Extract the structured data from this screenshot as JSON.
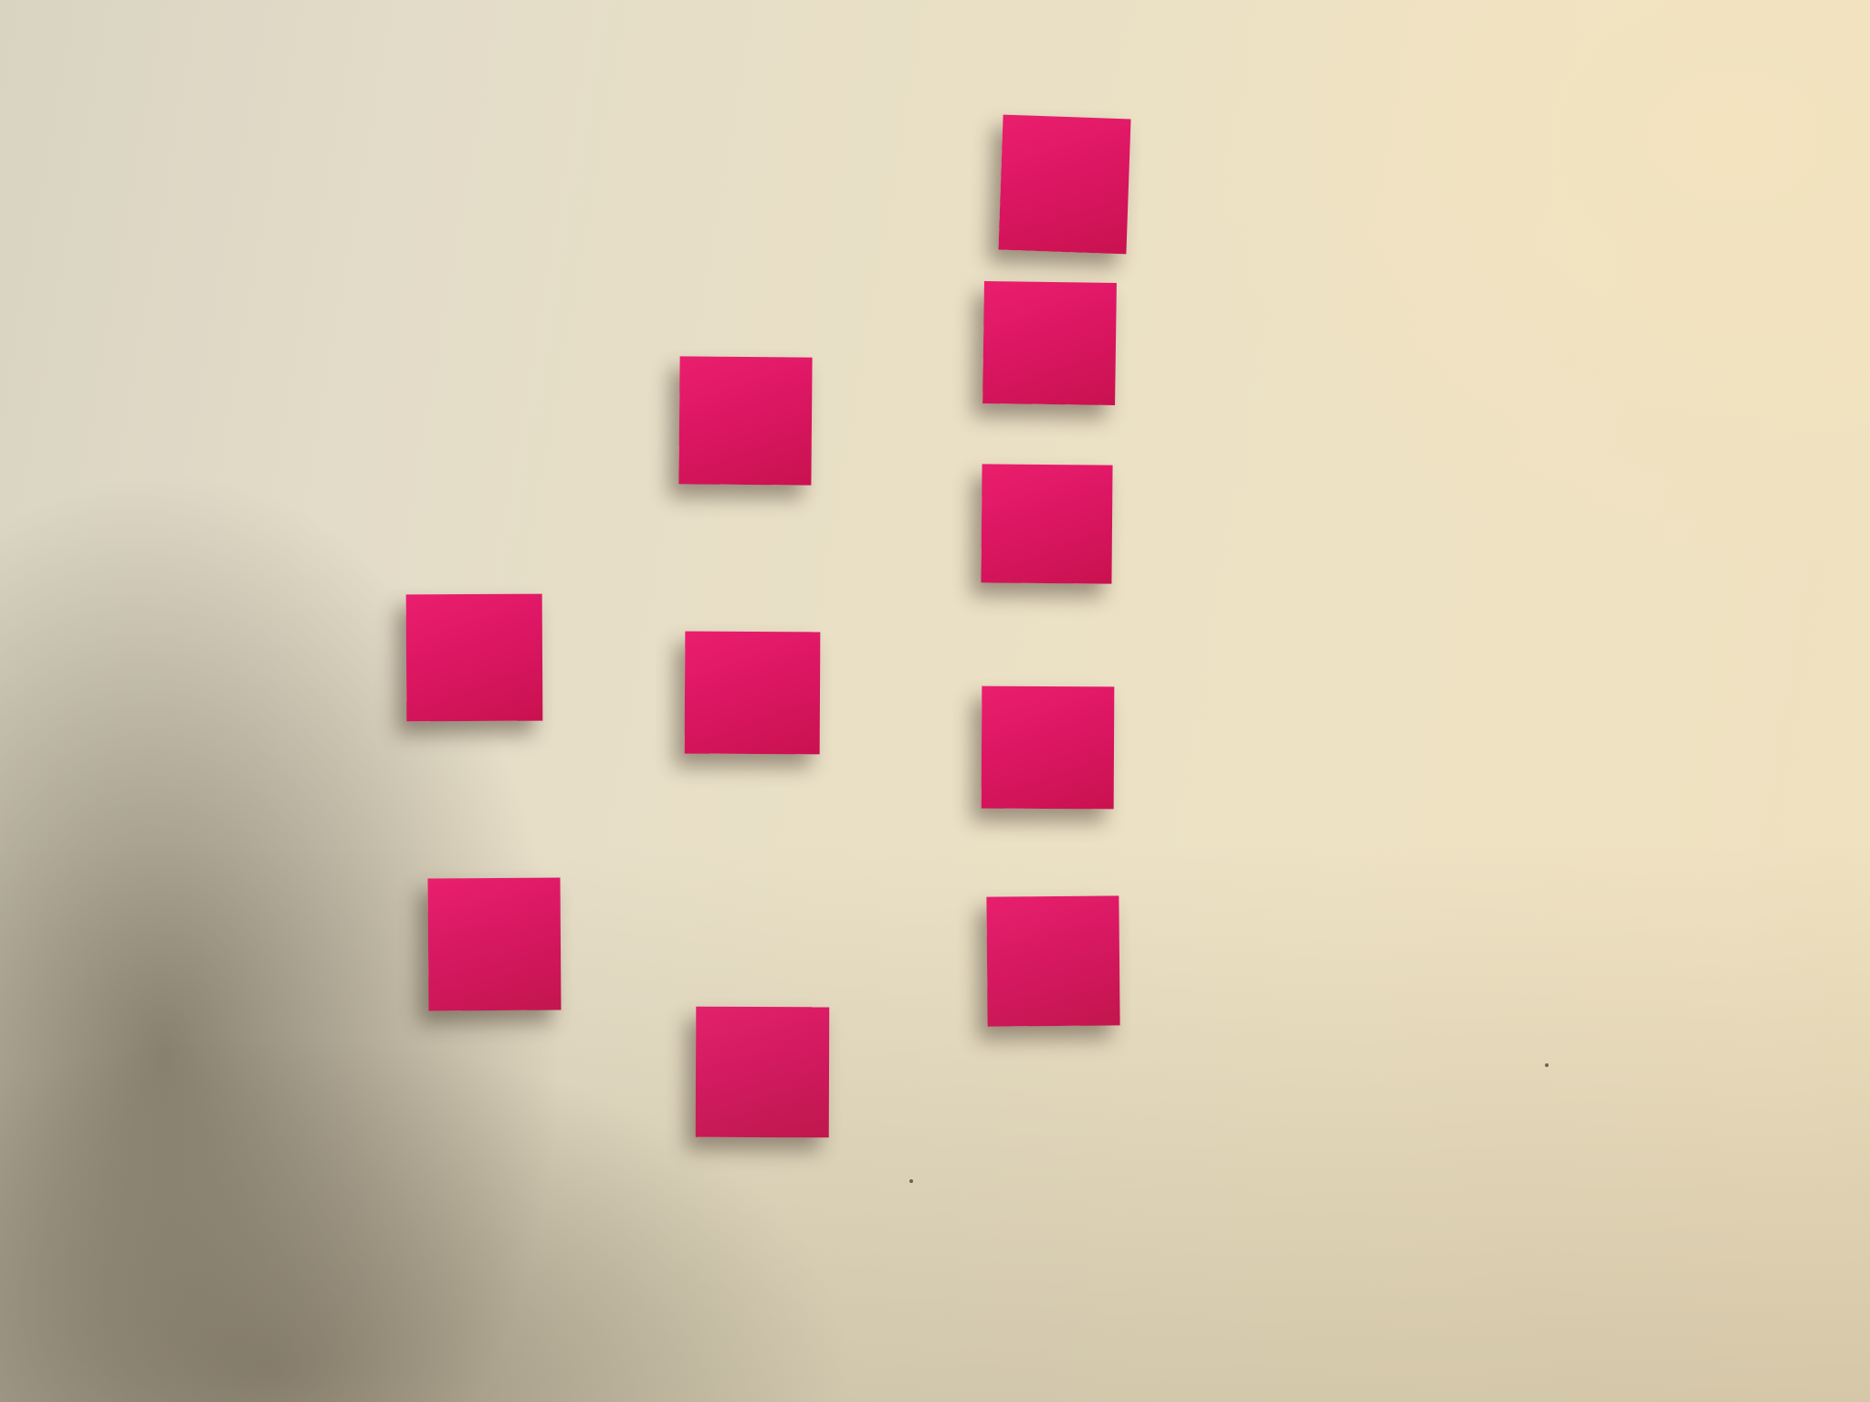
{
  "scene": {
    "wall_color": "#e6dec7",
    "note_color": "#e01865",
    "note_count": 10
  }
}
